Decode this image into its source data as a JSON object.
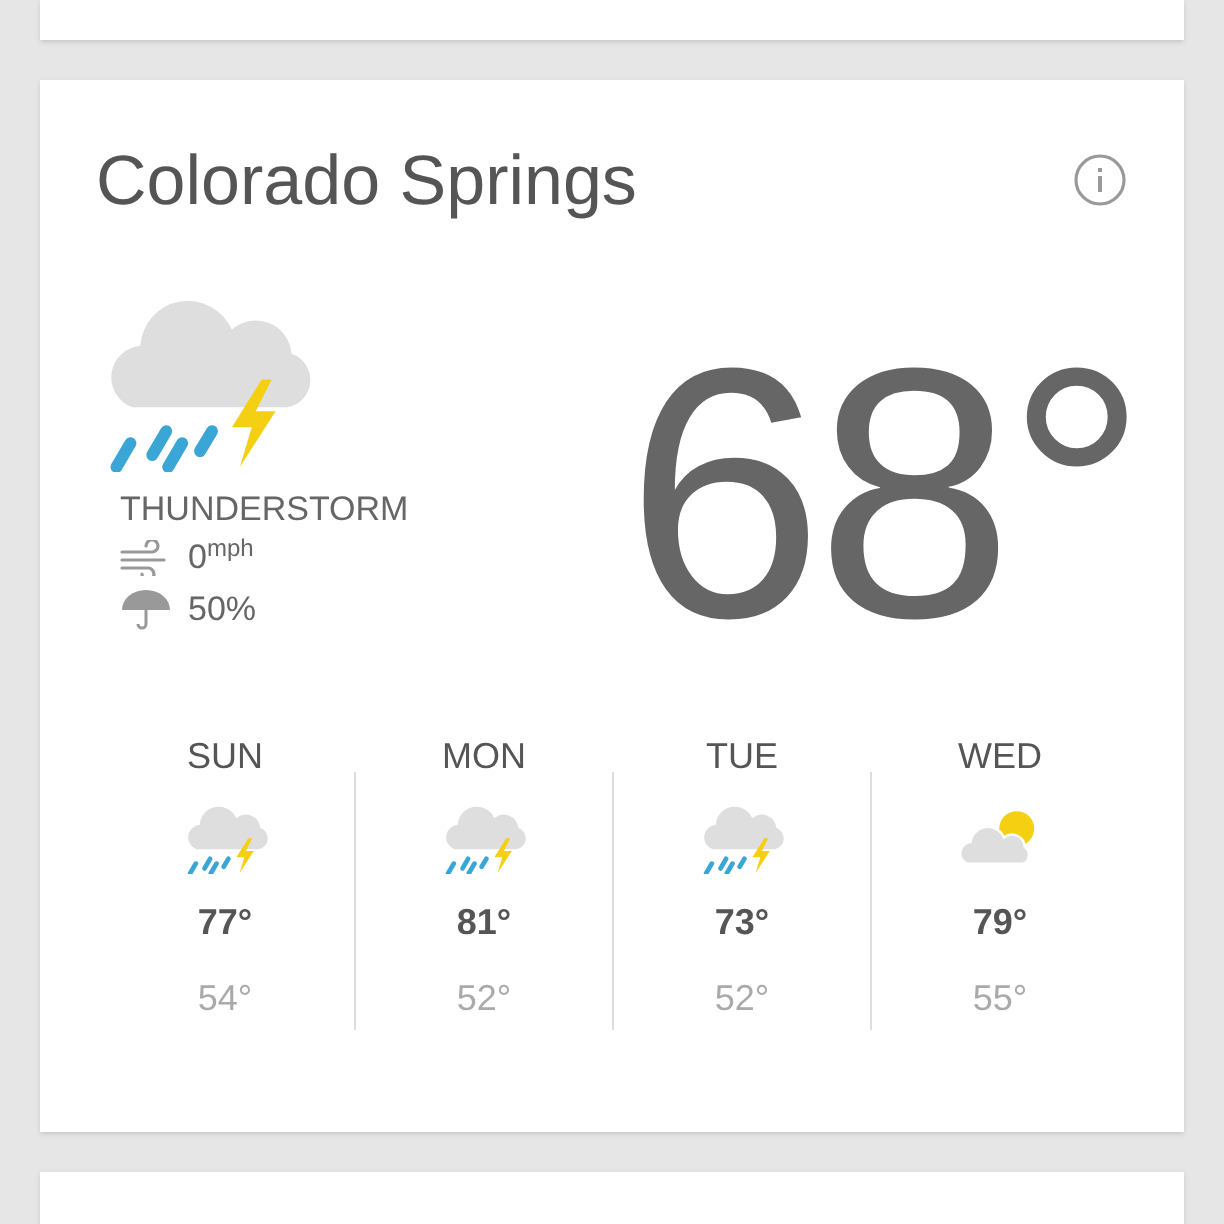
{
  "card": {
    "city": "Colorado Springs",
    "condition": "THUNDERSTORM",
    "kind": "storm",
    "wind": "0",
    "wind_unit": "mph",
    "precipitation": "50%",
    "temperature": "68°"
  },
  "forecast": [
    {
      "day": "SUN",
      "kind": "storm",
      "high": "77°",
      "low": "54°"
    },
    {
      "day": "MON",
      "kind": "storm",
      "high": "81°",
      "low": "52°"
    },
    {
      "day": "TUE",
      "kind": "storm",
      "high": "73°",
      "low": "52°"
    },
    {
      "day": "WED",
      "kind": "partly_cloudy",
      "high": "79°",
      "low": "55°"
    }
  ]
}
